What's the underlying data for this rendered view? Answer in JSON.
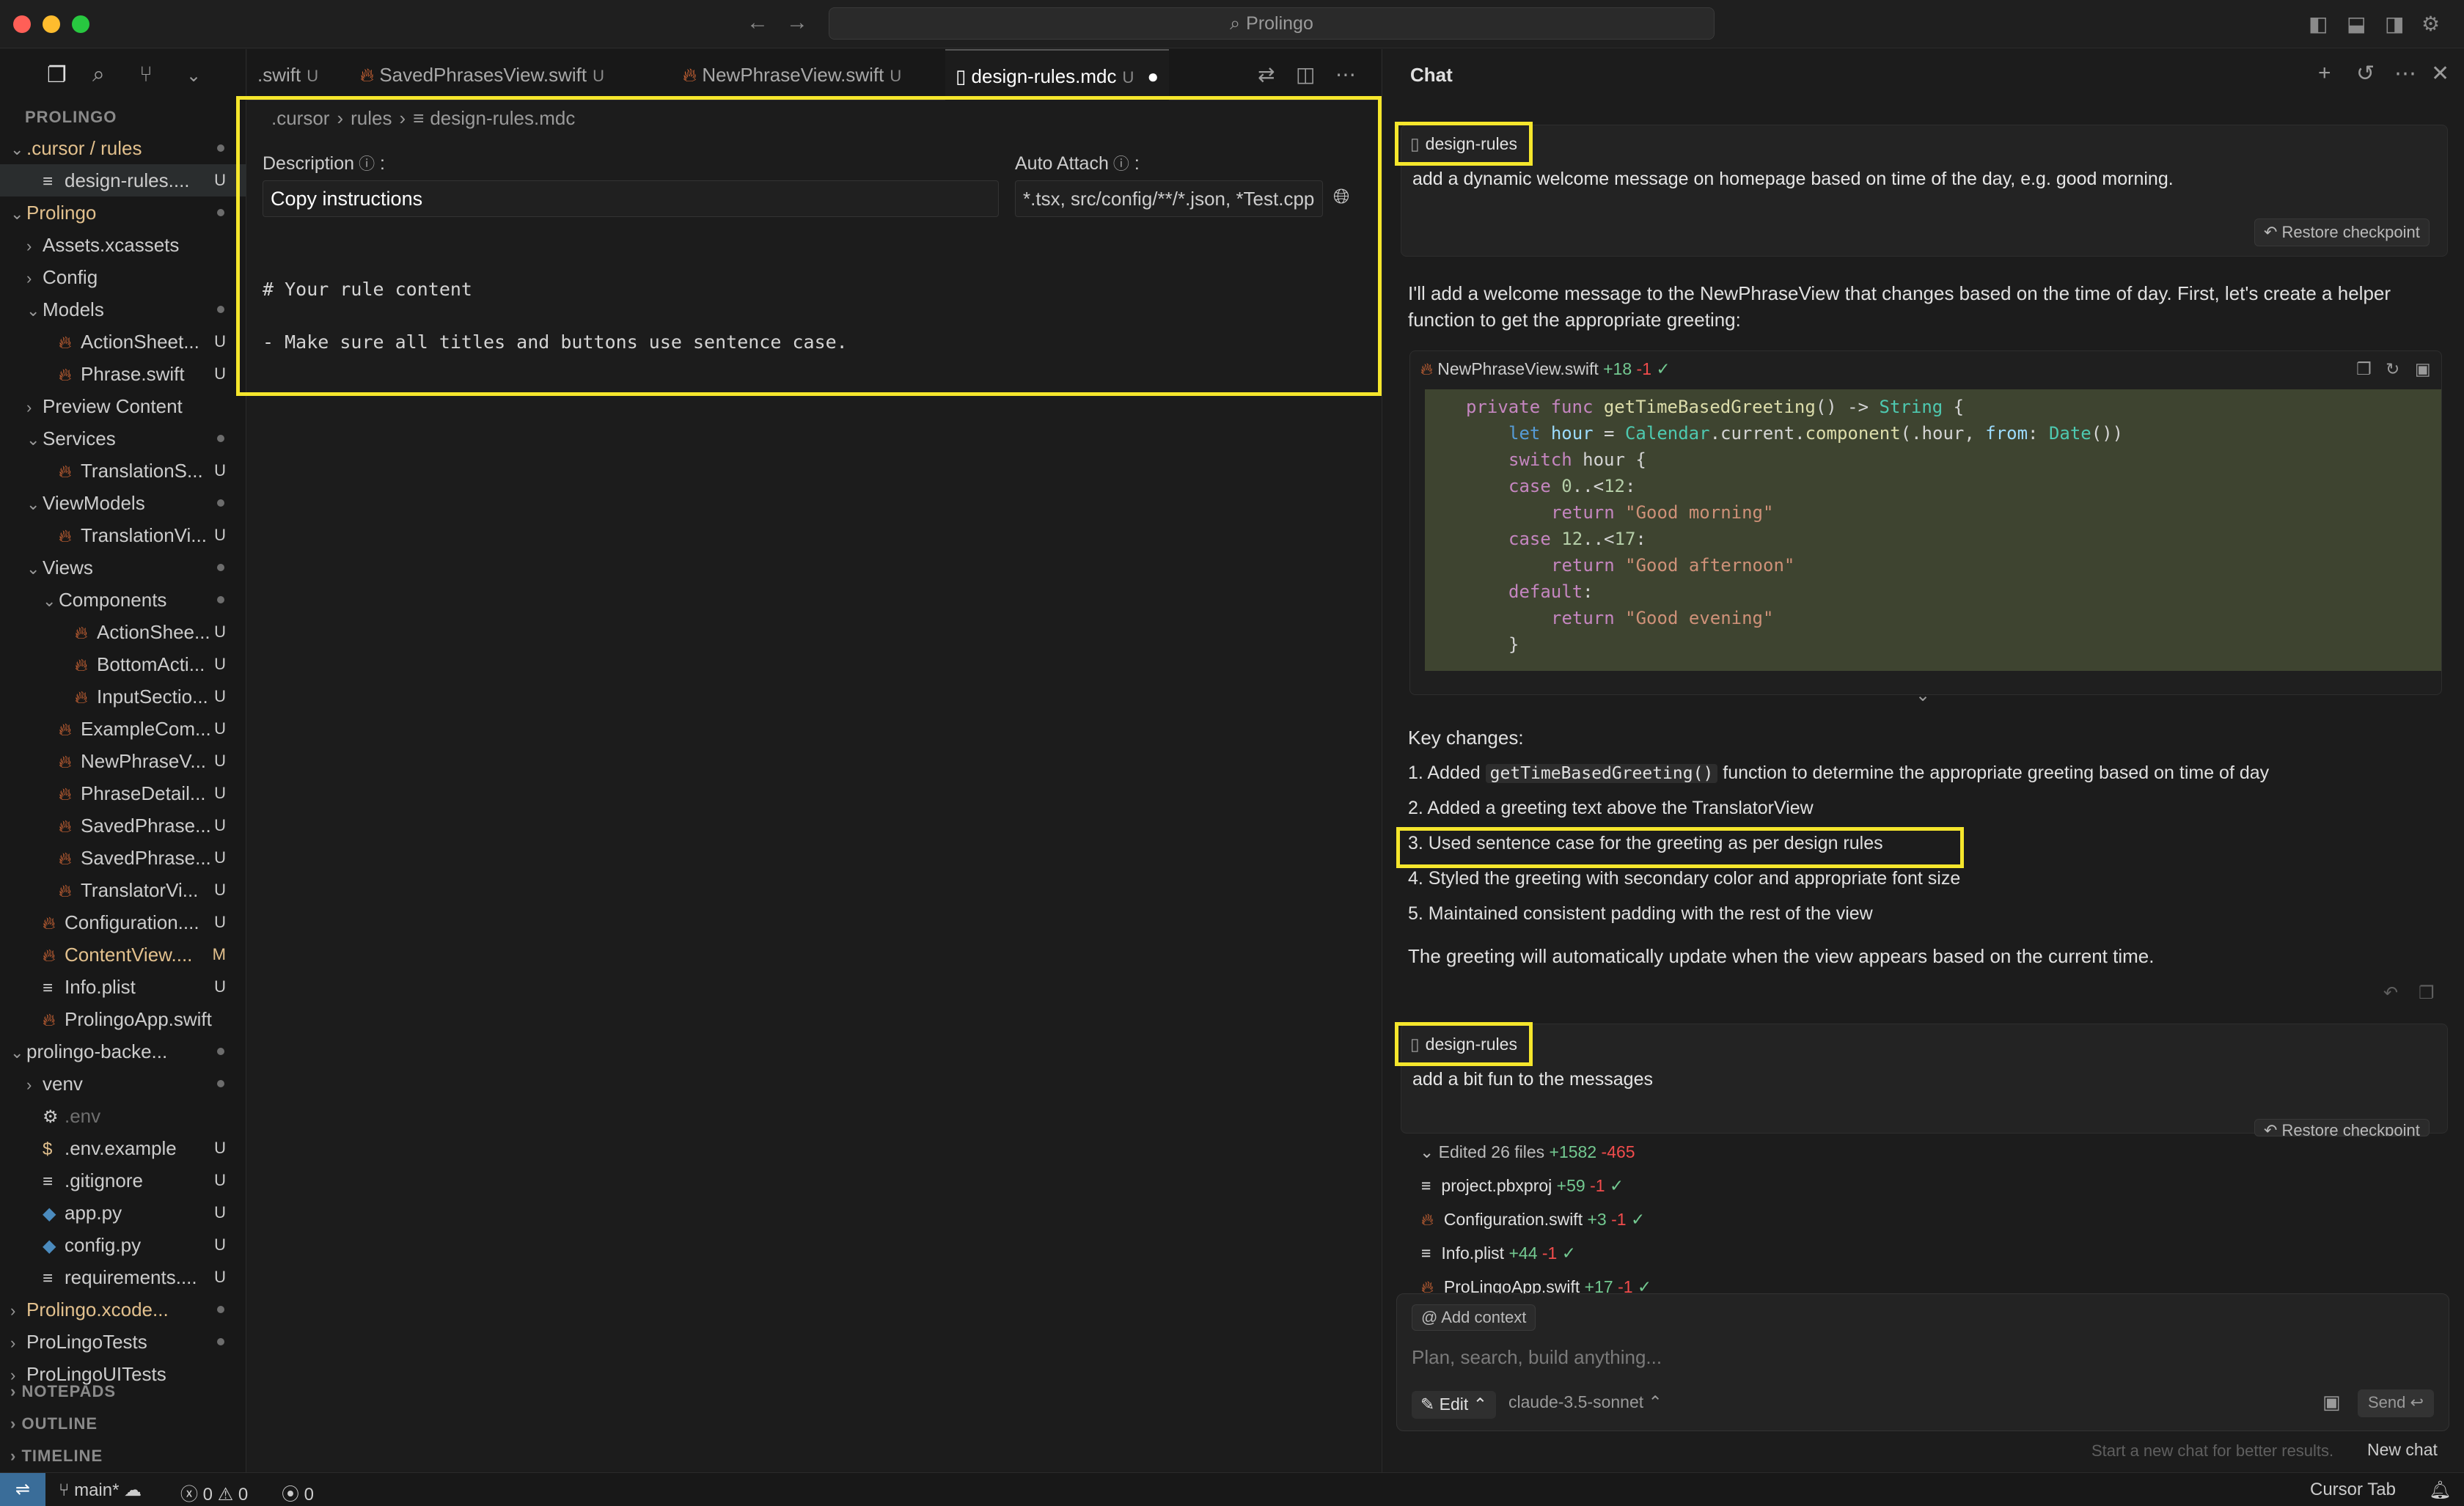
{
  "window": {
    "search_text": "Prolingo"
  },
  "sidebar": {
    "title": "PROLINGO",
    "tree": [
      {
        "indent": 1,
        "type": "folder-open",
        "name": ".cursor / rules",
        "status": "dot",
        "cls": "mod"
      },
      {
        "indent": 2,
        "type": "doc",
        "name": "design-rules....",
        "status": "U",
        "cls": "",
        "selected": true
      },
      {
        "indent": 1,
        "type": "folder-open",
        "name": "Prolingo",
        "status": "dot",
        "cls": "mod"
      },
      {
        "indent": 2,
        "type": "folder",
        "name": "Assets.xcassets",
        "status": "",
        "cls": ""
      },
      {
        "indent": 2,
        "type": "folder",
        "name": "Config",
        "status": "",
        "cls": ""
      },
      {
        "indent": 2,
        "type": "folder-open",
        "name": "Models",
        "status": "dot",
        "cls": "green"
      },
      {
        "indent": 3,
        "type": "swift",
        "name": "ActionSheet...",
        "status": "U",
        "cls": "green"
      },
      {
        "indent": 3,
        "type": "swift",
        "name": "Phrase.swift",
        "status": "U",
        "cls": "green"
      },
      {
        "indent": 2,
        "type": "folder",
        "name": "Preview Content",
        "status": "",
        "cls": ""
      },
      {
        "indent": 2,
        "type": "folder-open",
        "name": "Services",
        "status": "dot",
        "cls": "green"
      },
      {
        "indent": 3,
        "type": "swift",
        "name": "TranslationS...",
        "status": "U",
        "cls": "green"
      },
      {
        "indent": 2,
        "type": "folder-open",
        "name": "ViewModels",
        "status": "dot",
        "cls": "green"
      },
      {
        "indent": 3,
        "type": "swift",
        "name": "TranslationVi...",
        "status": "U",
        "cls": "green"
      },
      {
        "indent": 2,
        "type": "folder-open",
        "name": "Views",
        "status": "dot",
        "cls": "green"
      },
      {
        "indent": 3,
        "type": "folder-open",
        "name": "Components",
        "status": "dot",
        "cls": "green"
      },
      {
        "indent": 4,
        "type": "swift",
        "name": "ActionShee...",
        "status": "U",
        "cls": "green"
      },
      {
        "indent": 4,
        "type": "swift",
        "name": "BottomActi...",
        "status": "U",
        "cls": "green"
      },
      {
        "indent": 4,
        "type": "swift",
        "name": "InputSectio...",
        "status": "U",
        "cls": "green"
      },
      {
        "indent": 3,
        "type": "swift",
        "name": "ExampleCom...",
        "status": "U",
        "cls": "green"
      },
      {
        "indent": 3,
        "type": "swift",
        "name": "NewPhraseV...",
        "status": "U",
        "cls": "green"
      },
      {
        "indent": 3,
        "type": "swift",
        "name": "PhraseDetail...",
        "status": "U",
        "cls": "green"
      },
      {
        "indent": 3,
        "type": "swift",
        "name": "SavedPhrase...",
        "status": "U",
        "cls": "green"
      },
      {
        "indent": 3,
        "type": "swift",
        "name": "SavedPhrase...",
        "status": "U",
        "cls": "green"
      },
      {
        "indent": 3,
        "type": "swift",
        "name": "TranslatorVi...",
        "status": "U",
        "cls": "green"
      },
      {
        "indent": 2,
        "type": "swift",
        "name": "Configuration....",
        "status": "U",
        "cls": "green"
      },
      {
        "indent": 2,
        "type": "swift",
        "name": "ContentView....",
        "status": "M",
        "cls": "mod"
      },
      {
        "indent": 2,
        "type": "doc",
        "name": "Info.plist",
        "status": "U",
        "cls": "green"
      },
      {
        "indent": 2,
        "type": "swift",
        "name": "ProlingoApp.swift",
        "status": "",
        "cls": ""
      },
      {
        "indent": 1,
        "type": "folder-open",
        "name": "prolingo-backe...",
        "status": "dot",
        "cls": "green"
      },
      {
        "indent": 2,
        "type": "folder",
        "name": "venv",
        "status": "dot",
        "cls": ""
      },
      {
        "indent": 2,
        "type": "gear",
        "name": ".env",
        "status": "",
        "cls": "dim"
      },
      {
        "indent": 2,
        "type": "dollar",
        "name": ".env.example",
        "status": "U",
        "cls": "green"
      },
      {
        "indent": 2,
        "type": "doc",
        "name": ".gitignore",
        "status": "U",
        "cls": "green"
      },
      {
        "indent": 2,
        "type": "py",
        "name": "app.py",
        "status": "U",
        "cls": "green"
      },
      {
        "indent": 2,
        "type": "py",
        "name": "config.py",
        "status": "U",
        "cls": "green"
      },
      {
        "indent": 2,
        "type": "doc",
        "name": "requirements....",
        "status": "U",
        "cls": "green"
      },
      {
        "indent": 1,
        "type": "folder",
        "name": "Prolingo.xcode...",
        "status": "dot",
        "cls": "mod"
      },
      {
        "indent": 1,
        "type": "folder",
        "name": "ProLingoTests",
        "status": "dot",
        "cls": "green"
      },
      {
        "indent": 1,
        "type": "folder",
        "name": "ProLingoUITests",
        "status": "",
        "cls": "green"
      }
    ],
    "sections": [
      "NOTEPADS",
      "OUTLINE",
      "TIMELINE"
    ]
  },
  "editor": {
    "tabs": [
      {
        "name": ".swift",
        "status": "U",
        "icon": ""
      },
      {
        "name": "SavedPhrasesView.swift",
        "status": "U",
        "icon": "swift"
      },
      {
        "name": "NewPhraseView.swift",
        "status": "U",
        "icon": "swift"
      },
      {
        "name": "design-rules.mdc",
        "status": "U",
        "icon": "doc",
        "active": true
      }
    ],
    "breadcrumb": [
      ".cursor",
      "rules",
      "design-rules.mdc"
    ],
    "description_label": "Description",
    "description_value": "Copy instructions",
    "auto_attach_label": "Auto Attach",
    "auto_attach_value": "*.tsx, src/config/**/*.json, *Test.cpp",
    "content_heading": "# Your rule content",
    "content_rule": "- Make sure all titles and buttons use sentence case."
  },
  "chat": {
    "title": "Chat",
    "rule_chip": "design-rules",
    "msg1": "add a dynamic welcome message on homepage based on time of the day, e.g. good morning.",
    "restore_label": "Restore checkpoint",
    "ai_intro_1": "I'll add a welcome message to the NewPhraseView that changes based on the time of day. First, let's create a helper",
    "ai_intro_2": "function to get the appropriate greeting:",
    "code_file": "NewPhraseView.swift",
    "code_added": "+18",
    "code_removed": "-1",
    "key_changes_title": "Key changes:",
    "key_changes": [
      {
        "prefix": "1. Added ",
        "code": "getTimeBasedGreeting()",
        "suffix": " function to determine the appropriate greeting based on time of day"
      },
      {
        "prefix": "2. Added a greeting text above the TranslatorView",
        "code": "",
        "suffix": ""
      },
      {
        "prefix": "3. Used sentence case for the greeting as per design rules",
        "code": "",
        "suffix": ""
      },
      {
        "prefix": "4. Styled the greeting with secondary color and appropriate font size",
        "code": "",
        "suffix": ""
      },
      {
        "prefix": "5. Maintained consistent padding with the rest of the view",
        "code": "",
        "suffix": ""
      }
    ],
    "ai_outro": "The greeting will automatically update when the view appears based on the current time.",
    "msg2": "add a bit fun to the messages",
    "edited_summary": "Edited 26 files",
    "edited_added": "+1582",
    "edited_removed": "-465",
    "edited_files": [
      {
        "name": "project.pbxproj",
        "added": "+59",
        "removed": "-1",
        "icon": "doc"
      },
      {
        "name": "Configuration.swift",
        "added": "+3",
        "removed": "-1",
        "icon": "swift"
      },
      {
        "name": "Info.plist",
        "added": "+44",
        "removed": "-1",
        "icon": "doc"
      },
      {
        "name": "ProLingoApp.swift",
        "added": "+17",
        "removed": "-1",
        "icon": "swift"
      }
    ],
    "add_context": "Add context",
    "composer_placeholder": "Plan, search, build anything...",
    "mode": "Edit",
    "model": "claude-3.5-sonnet",
    "send": "Send",
    "new_chat_hint": "Start a new chat for better results.",
    "new_chat": "New chat"
  },
  "statusbar": {
    "branch": "main*",
    "errors": "0",
    "warnings": "0",
    "ports": "0",
    "right": "Cursor Tab"
  },
  "colors": {
    "highlight": "#f5e62c",
    "swift": "#f0733a",
    "git_untracked": "#73c991",
    "git_modified": "#e2c08d"
  }
}
